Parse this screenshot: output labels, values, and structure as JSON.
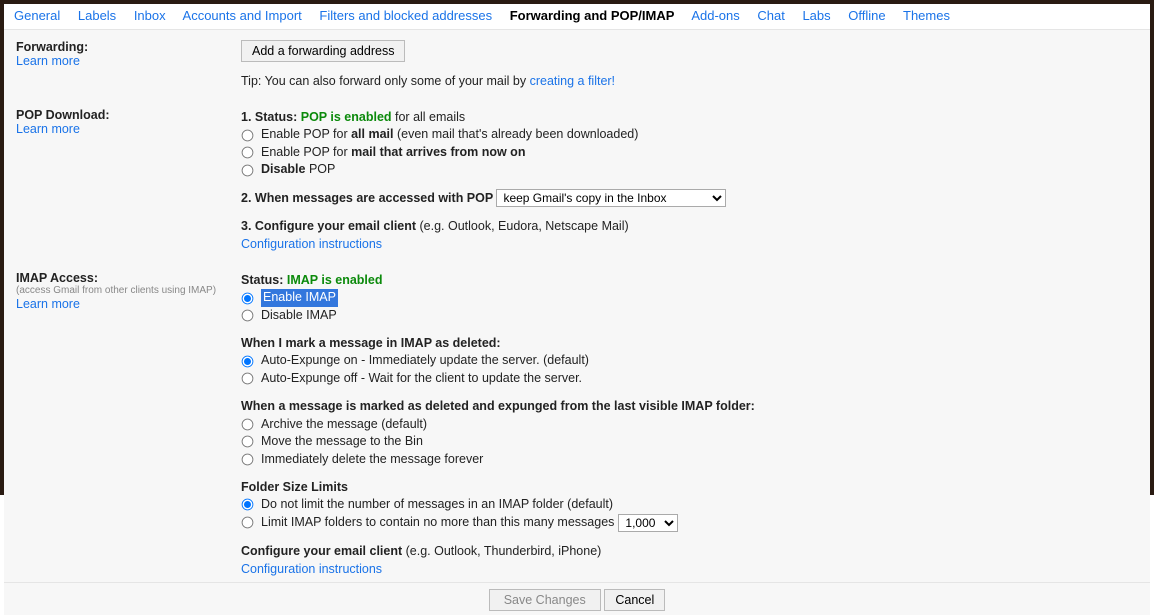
{
  "tabs": {
    "general": "General",
    "labels": "Labels",
    "inbox": "Inbox",
    "accounts": "Accounts and Import",
    "filters": "Filters and blocked addresses",
    "forwarding": "Forwarding and POP/IMAP",
    "addons": "Add-ons",
    "chat": "Chat",
    "labs": "Labs",
    "offline": "Offline",
    "themes": "Themes"
  },
  "forwarding": {
    "title": "Forwarding:",
    "learn_more": "Learn more",
    "add_btn": "Add a forwarding address",
    "tip_prefix": "Tip: You can also forward only some of your mail by ",
    "tip_link": "creating a filter!"
  },
  "pop": {
    "title": "POP Download:",
    "learn_more": "Learn more",
    "status_label": "1. Status: ",
    "status_value": "POP is enabled",
    "status_suffix": " for all emails",
    "enable_all_prefix": "Enable POP for ",
    "enable_all_bold": "all mail",
    "enable_all_suffix": " (even mail that's already been downloaded)",
    "enable_now_prefix": "Enable POP for ",
    "enable_now_bold": "mail that arrives from now on",
    "disable_prefix": "Disable",
    "disable_suffix": " POP",
    "access_label": "2. When messages are accessed with POP ",
    "access_select": "keep Gmail's copy in the Inbox",
    "configure_prefix": "3. Configure your email client",
    "configure_suffix": " (e.g. Outlook, Eudora, Netscape Mail)",
    "config_link": "Configuration instructions"
  },
  "imap": {
    "title": "IMAP Access:",
    "subtitle": "(access Gmail from other clients using IMAP)",
    "learn_more": "Learn more",
    "status_label": "Status: ",
    "status_value": "IMAP is enabled",
    "enable": "Enable IMAP",
    "disable": "Disable IMAP",
    "deleted_heading": "When I mark a message in IMAP as deleted:",
    "expunge_on": "Auto-Expunge on - Immediately update the server. (default)",
    "expunge_off": "Auto-Expunge off - Wait for the client to update the server.",
    "expunged_heading": "When a message is marked as deleted and expunged from the last visible IMAP folder:",
    "archive": "Archive the message (default)",
    "move_bin": "Move the message to the Bin",
    "delete_forever": "Immediately delete the message forever",
    "folder_heading": "Folder Size Limits",
    "nolimit": "Do not limit the number of messages in an IMAP folder (default)",
    "limit_prefix": "Limit IMAP folders to contain no more than this many messages ",
    "limit_value": "1,000",
    "configure_prefix": "Configure your email client",
    "configure_suffix": " (e.g. Outlook, Thunderbird, iPhone)",
    "config_link": "Configuration instructions"
  },
  "footer": {
    "save": "Save Changes",
    "cancel": "Cancel"
  }
}
